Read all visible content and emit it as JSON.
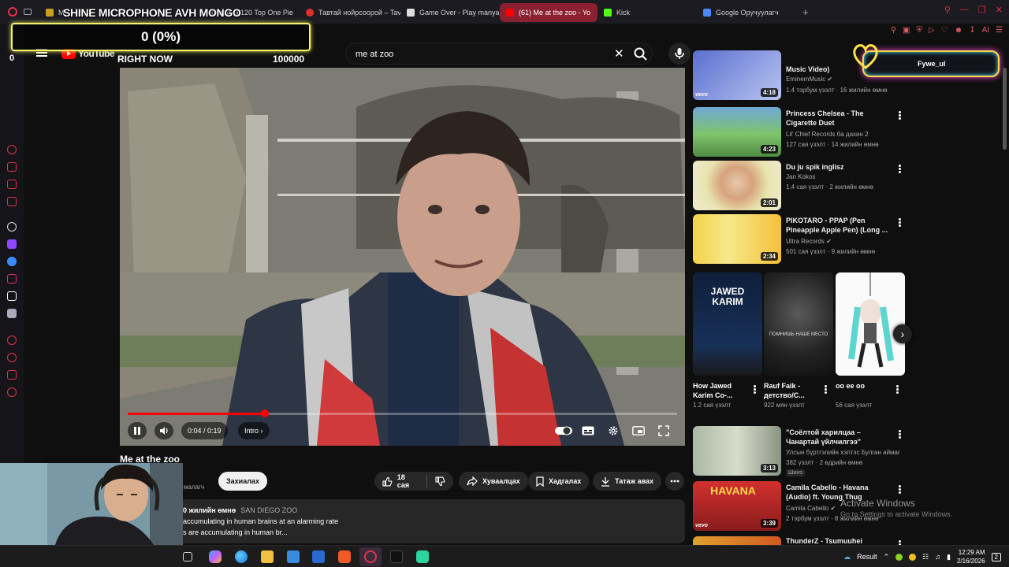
{
  "browser": {
    "tabs": [
      {
        "label": "M",
        "active": false
      },
      {
        "label": "Create a 120 Top One Pie",
        "active": false
      },
      {
        "label": "Тавтай нойрсоорой – Tav",
        "active": false
      },
      {
        "label": "Game Over - Play manyak",
        "active": false
      },
      {
        "label": "(61) Me at the zoo - Yo",
        "active": true
      },
      {
        "label": "Kick",
        "active": false
      },
      {
        "label": "Google Оручуулагч",
        "active": false
      }
    ],
    "new_tab": "+",
    "ext_label": "AI"
  },
  "overlay": {
    "title": "SHINE MICROPHONE AVH MONGO",
    "goal_value": "0 (0%)",
    "goal_min": "0",
    "goal_label": "RIGHT NOW",
    "goal_max": "100000",
    "neon_label": "Fywe_ul"
  },
  "youtube": {
    "logo": "YouTube",
    "search_value": "me at zoo"
  },
  "player": {
    "progress": 0.25,
    "time": "0:04 / 0:19",
    "chapter": "Intro"
  },
  "video": {
    "title": "Me at the zoo",
    "channel_snippet": "малагч",
    "subscribe": "Захиалах",
    "likes": "18 сая",
    "share": "Хуваалцах",
    "save": "Хадгалах",
    "download": "Татаж авах",
    "desc_meta": "0 жилийн өмнө",
    "desc_location": "SAN DIEGO ZOO",
    "desc_line1": "accumulating in human brains at an alarming rate",
    "desc_line2": "s are accumulating in human br..."
  },
  "recommendations": [
    {
      "title": "Music Video)",
      "channel": "EminemMusic",
      "meta": "1.4 тэрбум үзэлт · 16 жилийн өмнө",
      "duration": "4:18",
      "vevo": true,
      "verified": true
    },
    {
      "title": "Princess Chelsea - The Cigarette Duet",
      "channel": "Lil' Chief Records бa дахин 2",
      "meta": "127 сая үзэлт · 14 жилийн өмнө",
      "duration": "4:23",
      "vevo": false,
      "verified": false
    },
    {
      "title": "Du ju spik inglisz",
      "channel": "Jan Kokos",
      "meta": "1.4 сая үзэлт · 2 жилийн өмнө",
      "duration": "2:01",
      "vevo": false,
      "verified": false
    },
    {
      "title": "PIKOTARO - PPAP (Pen Pineapple Apple Pen) (Long ...",
      "channel": "Ultra Records",
      "meta": "501 сая үзэлт · 9 жилийн өмнө",
      "duration": "2:34",
      "vevo": false,
      "verified": true
    },
    {
      "title": "\"Соёлтой харилцаа – Чанартай үйлчилгээ\"",
      "channel": "Улсын бүртгэлийн хэлтэс Булган аймаг",
      "meta": "382 үзэлт · 2 өдрийн өмнө",
      "duration": "3:13",
      "tag": "Шинэ",
      "vevo": false,
      "verified": false
    },
    {
      "title": "Camila Cabello - Havana (Audio) ft. Young Thug",
      "channel": "Camila Cabello",
      "meta": "2 тэрбум үзэлт · 8 жилийн өмнө",
      "duration": "3:39",
      "vevo": true,
      "verified": true
    },
    {
      "title": "ThunderZ - Tsumuuhei",
      "channel": "",
      "meta": "",
      "duration": "",
      "vevo": false,
      "verified": false
    }
  ],
  "shorts": [
    {
      "title": "How Jawed Karim Co-...",
      "views": "1.2 сая үзэлт",
      "thumb_text": "JAWED KARIM"
    },
    {
      "title": "Rauf Faik - детство/С...",
      "views": "922 мян үзэлт",
      "thumb_text": "ПОМНИШЬ НАШЕ МЕСТО"
    },
    {
      "title": "oo ee oo",
      "views": "56 сая үзэлт",
      "thumb_text": ""
    }
  ],
  "windows": {
    "activate_title": "Activate Windows",
    "activate_sub": "Go to Settings to activate Windows.",
    "weather": "Result",
    "time": "12:29 AM",
    "date": "2/16/2026",
    "notif_count": "2"
  },
  "colors": {
    "accent_red": "#ff0000",
    "opera_red": "#e0334a",
    "goal_border": "#f2f26a"
  }
}
